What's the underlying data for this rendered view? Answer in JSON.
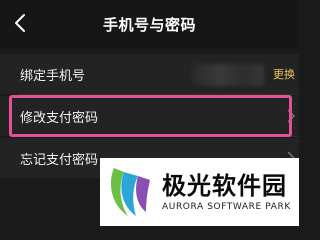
{
  "header": {
    "title": "手机号与密码",
    "back_icon": "chevron-left-icon"
  },
  "rows": [
    {
      "label": "绑定手机号",
      "value": "更换"
    },
    {
      "label": "修改支付密码"
    },
    {
      "label": "忘记支付密码"
    }
  ],
  "watermark": {
    "name": "极光软件园",
    "tagline": "AURORA SOFTWARE PARK"
  },
  "colors": {
    "background": "#1a1a1a",
    "row": "#232323",
    "accent_link": "#e6c255",
    "highlight": "#e05295"
  }
}
